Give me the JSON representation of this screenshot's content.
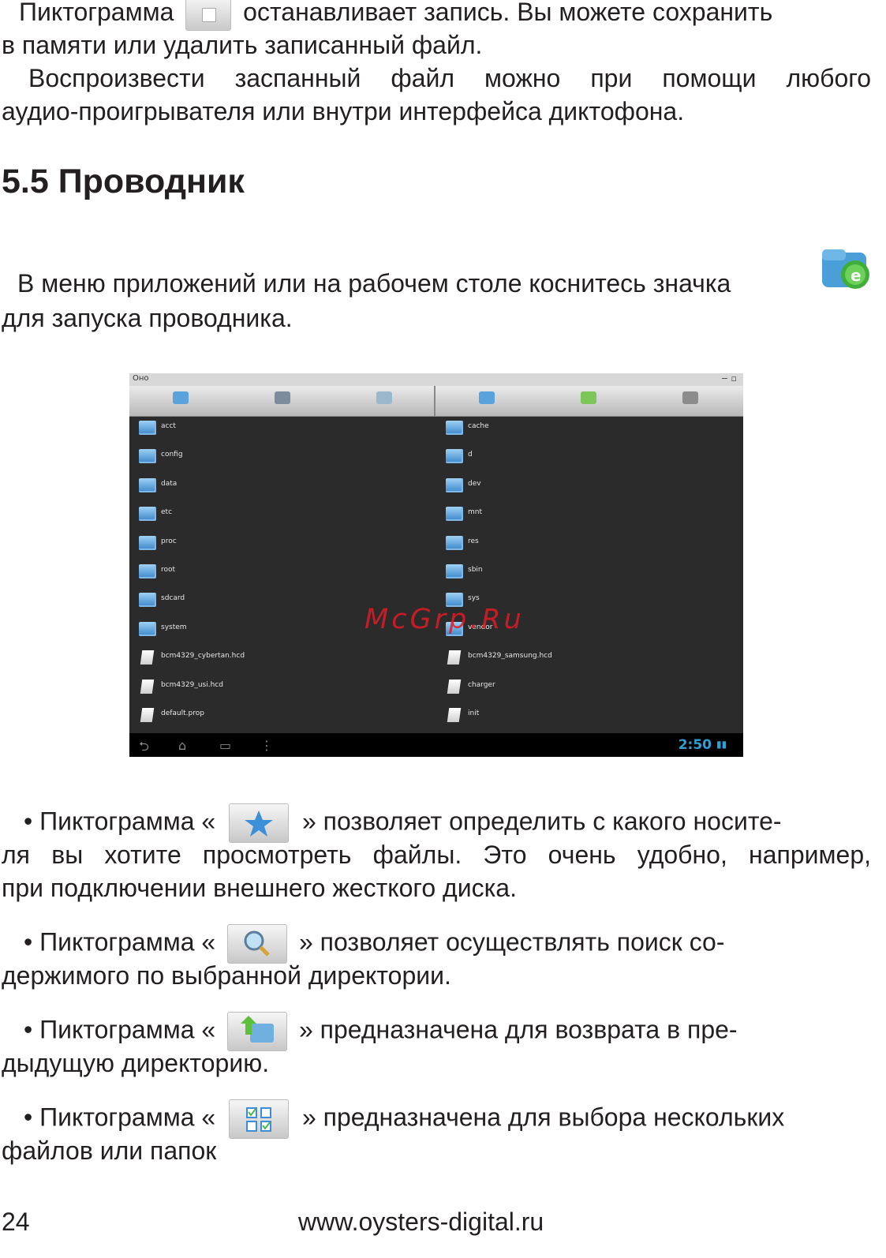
{
  "intro": {
    "line1_a": "Пиктограмма",
    "line1_b": "останавливает запись.  Вы можете сохранить",
    "line2": "в памяти или удалить записанный файл.",
    "line3": "Воспроизвести заспанный файл можно при помощи любого",
    "line4": "аудио-проигрывателя или внутри интерфейса диктофона."
  },
  "section": {
    "heading": "5.5 Проводник",
    "para_line1": "В меню приложений или на рабочем столе коснитесь значка",
    "para_line2": "для запуска проводника.",
    "icon": "file-explorer-icon"
  },
  "screenshot": {
    "status_text": "Оно",
    "toolbar_icons": [
      "home-icon",
      "list-icon",
      "search-icon",
      "folder-icon",
      "upload-icon",
      "menu-icon"
    ],
    "left_files": [
      {
        "name": "acct",
        "type": "folder"
      },
      {
        "name": "config",
        "type": "folder"
      },
      {
        "name": "data",
        "type": "folder"
      },
      {
        "name": "etc",
        "type": "folder"
      },
      {
        "name": "proc",
        "type": "folder"
      },
      {
        "name": "root",
        "type": "folder"
      },
      {
        "name": "sdcard",
        "type": "folder"
      },
      {
        "name": "system",
        "type": "folder"
      },
      {
        "name": "bcm4329_cybertan.hcd",
        "type": "file"
      },
      {
        "name": "bcm4329_usi.hcd",
        "type": "file"
      },
      {
        "name": "default.prop",
        "type": "file"
      }
    ],
    "right_files": [
      {
        "name": "cache",
        "type": "folder"
      },
      {
        "name": "d",
        "type": "folder"
      },
      {
        "name": "dev",
        "type": "folder"
      },
      {
        "name": "mnt",
        "type": "folder"
      },
      {
        "name": "res",
        "type": "folder"
      },
      {
        "name": "sbin",
        "type": "folder"
      },
      {
        "name": "sys",
        "type": "folder"
      },
      {
        "name": "vendor",
        "type": "folder"
      },
      {
        "name": "bcm4329_samsung.hcd",
        "type": "file"
      },
      {
        "name": "charger",
        "type": "file"
      },
      {
        "name": "init",
        "type": "file"
      }
    ],
    "time": "2:50"
  },
  "watermark": "McGrp.Ru",
  "bullets": [
    {
      "icon": "star-icon",
      "a": "• Пиктограмма «",
      "b": "» позволяет определить с какого носите-",
      "line2": "ля вы хотите просмотреть файлы. Это очень удобно, например,",
      "line3": "при подключении внешнего жесткого диска."
    },
    {
      "icon": "search-icon",
      "a": "• Пиктограмма «",
      "b": "» позволяет осуществлять поиск со-",
      "line2": "держимого по выбранной директории."
    },
    {
      "icon": "folder-up-icon",
      "a": "• Пиктограмма «",
      "b": "» предназначена для возврата в пре-",
      "line2": "дыдущую директорию."
    },
    {
      "icon": "multi-select-icon",
      "a": "• Пиктограмма «",
      "b": "» предназначена для выбора нескольких",
      "line2": "файлов или папок"
    }
  ],
  "footer": {
    "page_number": "24",
    "url": "www.oysters-digital.ru"
  }
}
